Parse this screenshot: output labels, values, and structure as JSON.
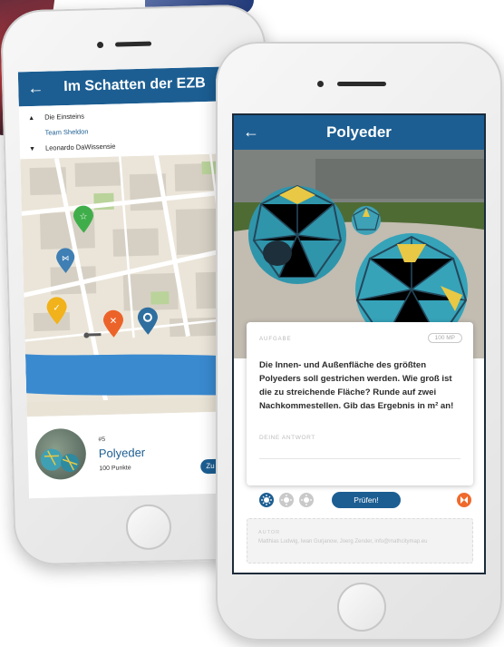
{
  "back_screen": {
    "title": "Im Schatten der EZB",
    "ranking": [
      {
        "label": "Die Einsteins",
        "icon": "▲"
      },
      {
        "label": "Team Sheldon",
        "icon": ""
      },
      {
        "label": "Leonardo DaWissensie",
        "icon": "▼"
      }
    ],
    "card": {
      "number": "#5",
      "name": "Polyeder",
      "points": "100 Punkte",
      "go_label": "Zu"
    }
  },
  "front_screen": {
    "title": "Polyeder",
    "task_label": "AUFGABE",
    "points_badge": "100 MP",
    "question": "Die Innen- und Außenfläche des größten Polyeders soll gestrichen werden. Wie groß ist die zu streichende Fläche? Runde auf zwei Nachkommestellen. Gib das Ergebnis in m² an!",
    "answer_placeholder": "DEINE ANTWORT",
    "check_label": "Prüfen!",
    "author_label": "AUTOR",
    "author_text": "Matthias Ludwig, Iwan Gurjanow, Joerg Zender, info@mathcitymap.eu"
  },
  "colors": {
    "primary": "#1c5e92",
    "accent": "#ef6a2c",
    "marker_green": "#3fae4a",
    "marker_yellow": "#f1b21b",
    "marker_orange": "#ec6329",
    "marker_blue": "#2f6fa0"
  }
}
